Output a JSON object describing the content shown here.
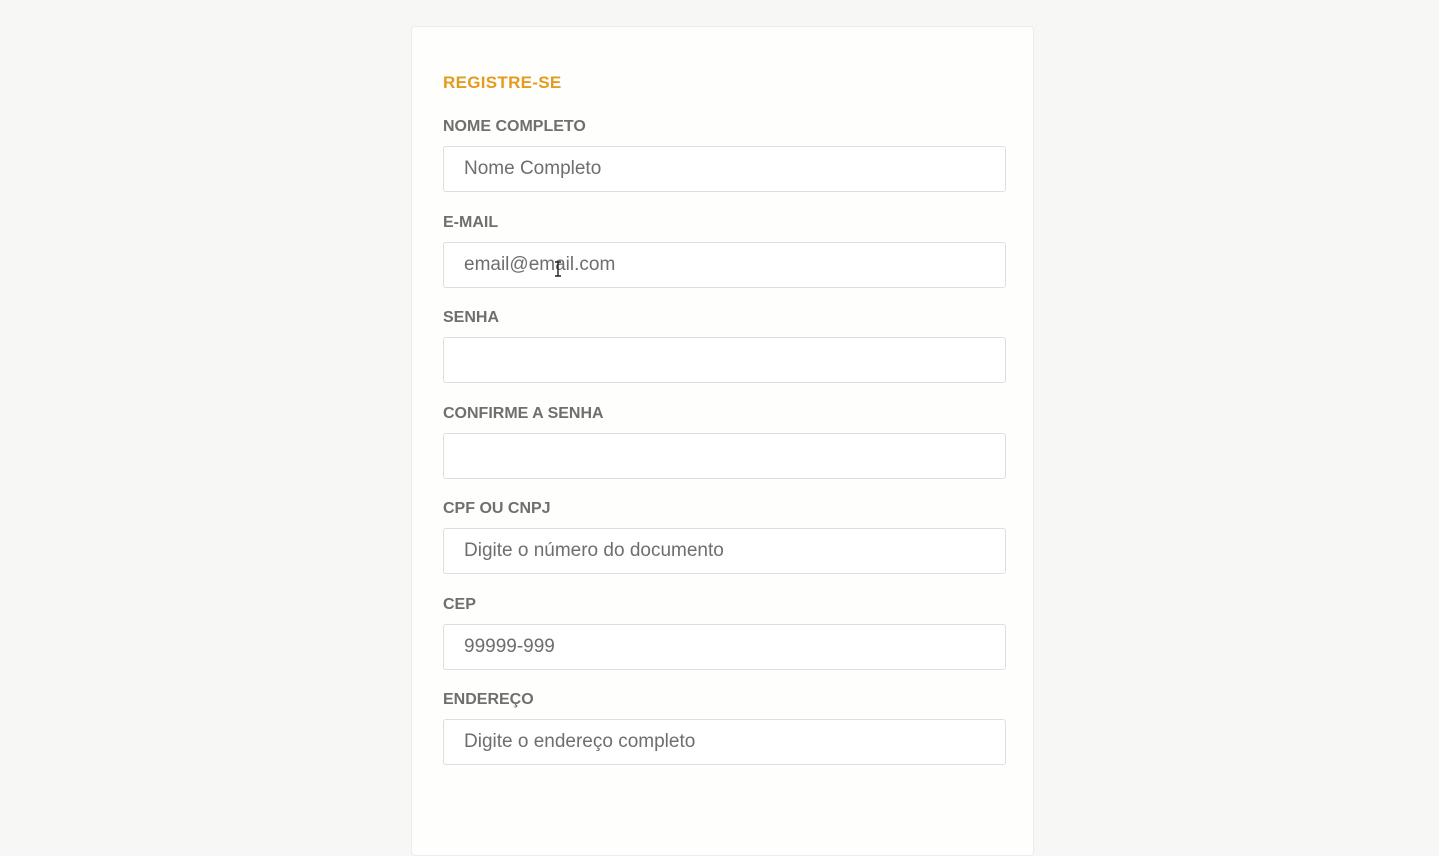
{
  "form": {
    "title": "REGISTRE-SE",
    "fields": [
      {
        "label": "NOME COMPLETO",
        "placeholder": "Nome Completo",
        "value": ""
      },
      {
        "label": "E-MAIL",
        "placeholder": "email@email.com",
        "value": ""
      },
      {
        "label": "SENHA",
        "placeholder": "",
        "value": ""
      },
      {
        "label": "CONFIRME A SENHA",
        "placeholder": "",
        "value": ""
      },
      {
        "label": "CPF OU CNPJ",
        "placeholder": "Digite o número do documento",
        "value": ""
      },
      {
        "label": "CEP",
        "placeholder": "99999-999",
        "value": ""
      },
      {
        "label": "ENDEREÇO",
        "placeholder": "Digite o endereço completo",
        "value": ""
      }
    ]
  },
  "colors": {
    "accent": "#e59b1e",
    "label": "#6f6f6b",
    "background": "#f7f7f5"
  },
  "cursor": {
    "icon": "text-cursor-icon"
  }
}
